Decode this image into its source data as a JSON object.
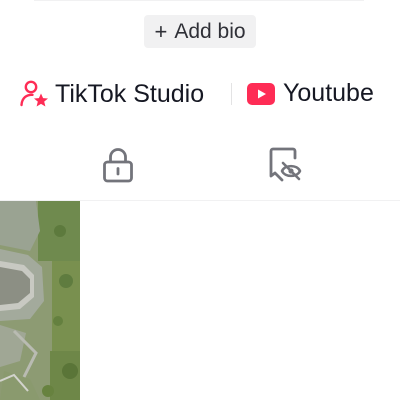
{
  "profile": {
    "add_bio_label": "Add bio",
    "add_bio_icon": "plus-icon"
  },
  "links": {
    "studio": {
      "label": "TikTok Studio",
      "icon": "person-star-icon",
      "icon_color": "#fe2c55"
    },
    "youtube": {
      "label": "Youtube",
      "icon": "youtube-icon",
      "icon_color": "#fe2c55"
    }
  },
  "tabs": [
    {
      "name": "private-videos",
      "icon": "lock-icon"
    },
    {
      "name": "liked-videos-hidden",
      "icon": "bookmark-eye-off-icon"
    }
  ],
  "videos": [
    {
      "thumbnail": "aerial-ruins-photo"
    }
  ],
  "colors": {
    "accent": "#fe2c55",
    "text": "#161823",
    "icon_gray": "#73747b",
    "chip_bg": "#f1f1f2"
  }
}
